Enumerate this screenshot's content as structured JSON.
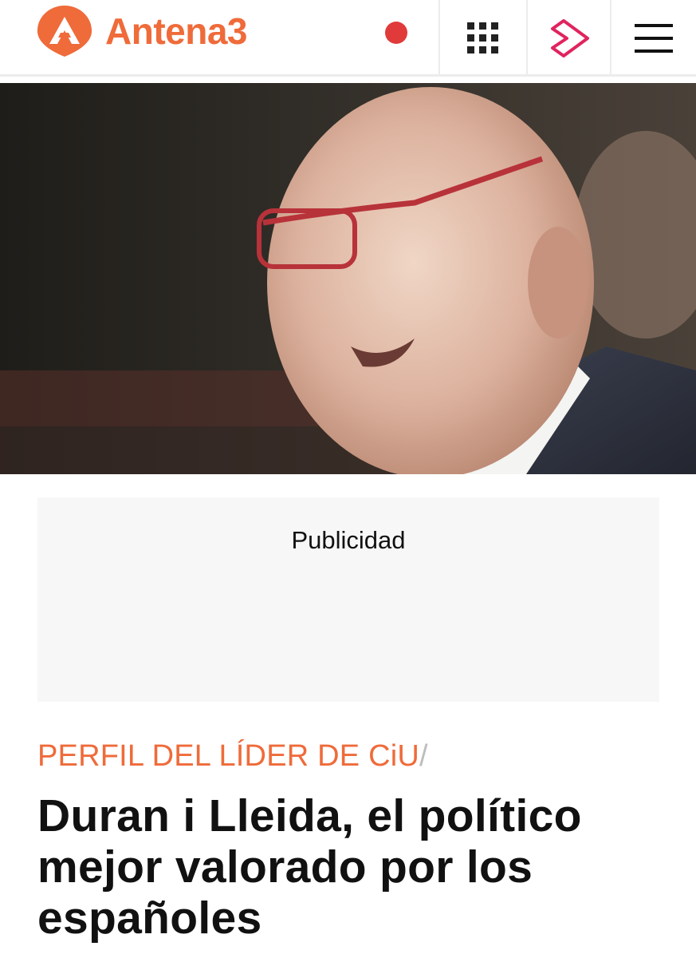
{
  "header": {
    "brand_name": "Antena3",
    "live_icon": "live-dot-icon",
    "apps_icon": "grid-icon",
    "player_icon": "atresplayer-icon",
    "menu_icon": "hamburger-menu-icon"
  },
  "hero": {
    "image": "news-photo-politician-speaking"
  },
  "ad": {
    "label": "Publicidad"
  },
  "article": {
    "kicker": "PERFIL DEL LÍDER DE CiU",
    "kicker_separator": "/",
    "headline": "Duran i Lleida, el político mejor valorado por los españoles"
  },
  "colors": {
    "brand_orange": "#ef6b3a",
    "live_red": "#e03a3a",
    "player_pink": "#e0245e"
  }
}
